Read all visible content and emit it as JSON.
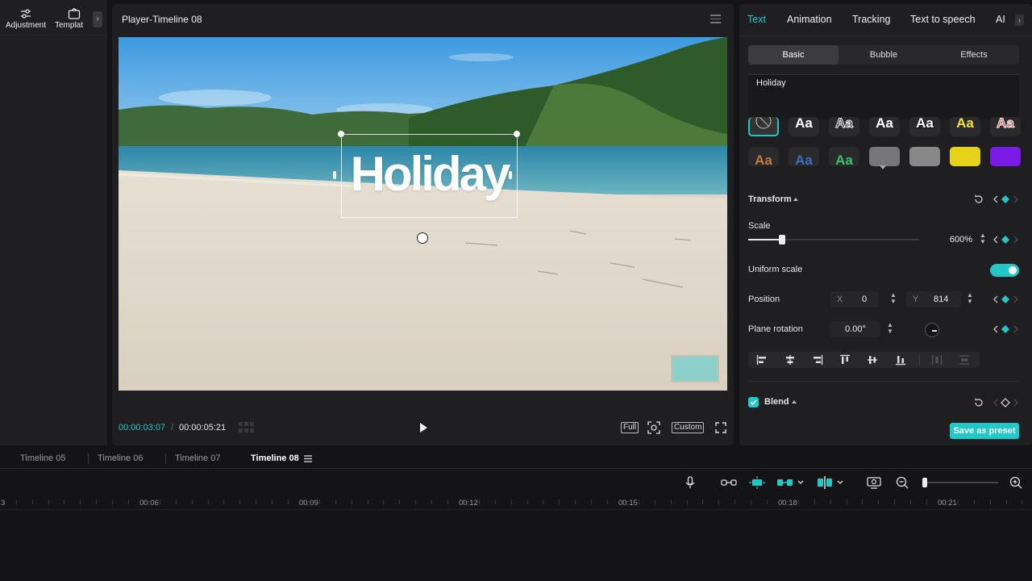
{
  "left_panel": {
    "tools": [
      {
        "label": "Adjustment",
        "icon": "sliders-icon"
      },
      {
        "label": "Templat",
        "icon": "template-icon"
      }
    ]
  },
  "player": {
    "title": "Player-Timeline 08",
    "overlay_text": "Holiday",
    "current_time": "00:00:03:07",
    "separator": "/",
    "total_time": "00:00:05:21",
    "full_label": "Full",
    "custom_label": "Custom"
  },
  "right_panel": {
    "tabs": [
      "Text",
      "Animation",
      "Tracking",
      "Text to speech",
      "AI"
    ],
    "active_tab": "Text",
    "subtabs": [
      "Basic",
      "Bubble",
      "Effects"
    ],
    "active_subtab": "Basic",
    "text_value": "Holiday",
    "style_presets_row1": [
      "Aa",
      "Aa",
      "Aa",
      "Aa",
      "Aa",
      "Aa"
    ],
    "style_presets_row2": [
      "Aa",
      "Aa",
      "Aa",
      "",
      "",
      "",
      ""
    ],
    "transform": {
      "label": "Transform",
      "scale_label": "Scale",
      "scale_value": "600%",
      "scale_slider_fraction": 0.2,
      "uniform_scale_label": "Uniform scale",
      "uniform_scale_on": true,
      "position_label": "Position",
      "x_label": "X",
      "x_value": "0",
      "y_label": "Y",
      "y_value": "814",
      "rotation_label": "Plane rotation",
      "rotation_value": "0.00°"
    },
    "blend_label": "Blend",
    "save_preset_label": "Save as preset",
    "accent_color": "#22c8c8"
  },
  "timeline": {
    "tabs": [
      "Timeline 05",
      "Timeline 06",
      "Timeline 07",
      "Timeline 08"
    ],
    "active_tab": "Timeline 08",
    "ruler_first_label": "3",
    "ruler_labels": [
      "00:06",
      "00:09",
      "00:12",
      "00:15",
      "00:18",
      "00:21"
    ]
  }
}
